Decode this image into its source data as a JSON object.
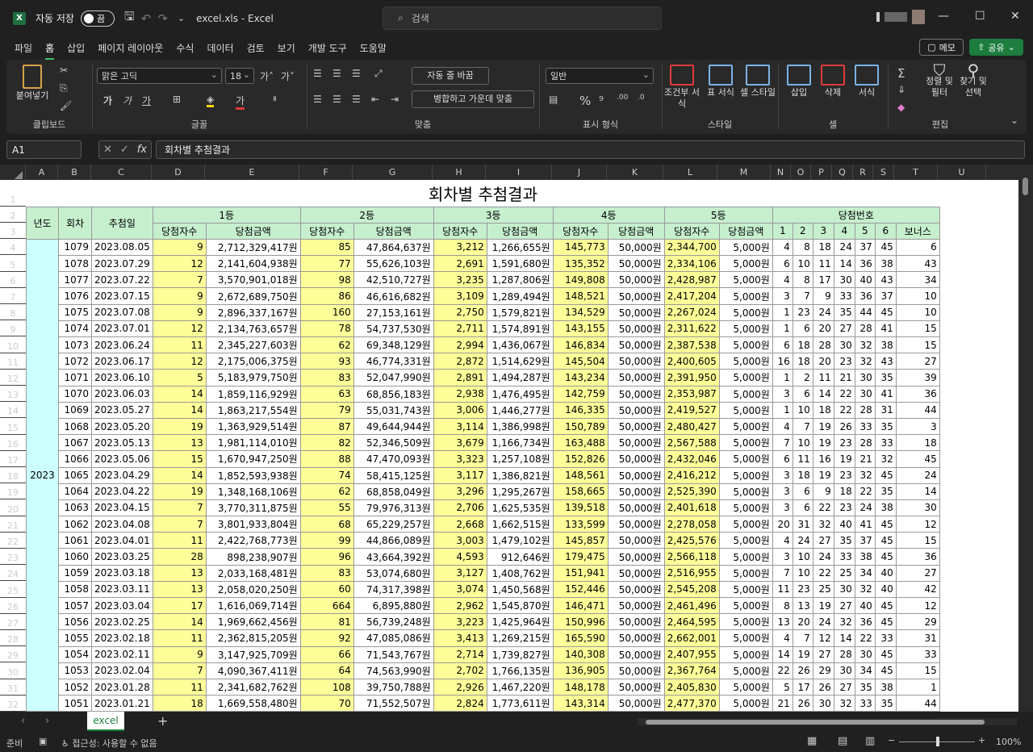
{
  "app": {
    "autosave_label": "자동 저장",
    "toggle_state": "끔",
    "filename": "excel.xls",
    "app_name": "Excel",
    "search_placeholder": "검색"
  },
  "menu": [
    "파일",
    "홈",
    "삽입",
    "페이지 레이아웃",
    "수식",
    "데이터",
    "검토",
    "보기",
    "개발 도구",
    "도움말"
  ],
  "menu_active_index": 1,
  "memo_label": "메모",
  "share_label": "공유",
  "ribbon": {
    "paste": "붙여넣기",
    "clipboard": "클립보드",
    "font_name": "맑은 고딕",
    "font_size": "18",
    "font": "글꼴",
    "wrap": "자동 줄 바꿈",
    "merge": "병합하고 가운데 맞춤",
    "align": "맞춤",
    "numfmt": "일반",
    "numfmt_group": "표시 형식",
    "cond_format": "조건부 서식",
    "table_format": "표 서식",
    "cell_style": "셀 스타일",
    "style_group": "스타일",
    "insert": "삽입",
    "delete": "삭제",
    "format": "서식",
    "cells_group": "셀",
    "sort_filter": "정렬 및 필터",
    "find_select": "찾기 및 선택",
    "edit_group": "편집"
  },
  "formula": {
    "name_box": "A1",
    "content": "회차별 추첨결과"
  },
  "columns": [
    "A",
    "B",
    "C",
    "D",
    "E",
    "F",
    "G",
    "H",
    "I",
    "J",
    "K",
    "L",
    "M",
    "N",
    "O",
    "P",
    "Q",
    "R",
    "S",
    "T",
    "U"
  ],
  "sheet": {
    "title": "회차별 추첨결과",
    "h_year": "년도",
    "h_round": "회차",
    "h_date": "추첨일",
    "ranks": [
      "1등",
      "2등",
      "3등",
      "4등",
      "5등"
    ],
    "h_count": "당첨자수",
    "h_amount": "당첨금액",
    "h_numbers": "당첨번호",
    "num_labels": [
      "1",
      "2",
      "3",
      "4",
      "5",
      "6",
      "보너스"
    ],
    "year": "2023",
    "rows": [
      [
        "1079",
        "2023.08.05",
        "9",
        "2,712,329,417원",
        "85",
        "47,864,637원",
        "3,212",
        "1,266,655원",
        "145,773",
        "50,000원",
        "2,344,700",
        "5,000원",
        "4",
        "8",
        "18",
        "24",
        "37",
        "45",
        "6"
      ],
      [
        "1078",
        "2023.07.29",
        "12",
        "2,141,604,938원",
        "77",
        "55,626,103원",
        "2,691",
        "1,591,680원",
        "135,352",
        "50,000원",
        "2,334,106",
        "5,000원",
        "6",
        "10",
        "11",
        "14",
        "36",
        "38",
        "43"
      ],
      [
        "1077",
        "2023.07.22",
        "7",
        "3,570,901,018원",
        "98",
        "42,510,727원",
        "3,235",
        "1,287,806원",
        "149,808",
        "50,000원",
        "2,428,987",
        "5,000원",
        "4",
        "8",
        "17",
        "30",
        "40",
        "43",
        "34"
      ],
      [
        "1076",
        "2023.07.15",
        "9",
        "2,672,689,750원",
        "86",
        "46,616,682원",
        "3,109",
        "1,289,494원",
        "148,521",
        "50,000원",
        "2,417,204",
        "5,000원",
        "3",
        "7",
        "9",
        "33",
        "36",
        "37",
        "10"
      ],
      [
        "1075",
        "2023.07.08",
        "9",
        "2,896,337,167원",
        "160",
        "27,153,161원",
        "2,750",
        "1,579,821원",
        "134,529",
        "50,000원",
        "2,267,024",
        "5,000원",
        "1",
        "23",
        "24",
        "35",
        "44",
        "45",
        "10"
      ],
      [
        "1074",
        "2023.07.01",
        "12",
        "2,134,763,657원",
        "78",
        "54,737,530원",
        "2,711",
        "1,574,891원",
        "143,155",
        "50,000원",
        "2,311,622",
        "5,000원",
        "1",
        "6",
        "20",
        "27",
        "28",
        "41",
        "15"
      ],
      [
        "1073",
        "2023.06.24",
        "11",
        "2,345,227,603원",
        "62",
        "69,348,129원",
        "2,994",
        "1,436,067원",
        "146,834",
        "50,000원",
        "2,387,538",
        "5,000원",
        "6",
        "18",
        "28",
        "30",
        "32",
        "38",
        "15"
      ],
      [
        "1072",
        "2023.06.17",
        "12",
        "2,175,006,375원",
        "93",
        "46,774,331원",
        "2,872",
        "1,514,629원",
        "145,504",
        "50,000원",
        "2,400,605",
        "5,000원",
        "16",
        "18",
        "20",
        "23",
        "32",
        "43",
        "27"
      ],
      [
        "1071",
        "2023.06.10",
        "5",
        "5,183,979,750원",
        "83",
        "52,047,990원",
        "2,891",
        "1,494,287원",
        "143,234",
        "50,000원",
        "2,391,950",
        "5,000원",
        "1",
        "2",
        "11",
        "21",
        "30",
        "35",
        "39"
      ],
      [
        "1070",
        "2023.06.03",
        "14",
        "1,859,116,929원",
        "63",
        "68,856,183원",
        "2,938",
        "1,476,495원",
        "142,759",
        "50,000원",
        "2,353,987",
        "5,000원",
        "3",
        "6",
        "14",
        "22",
        "30",
        "41",
        "36"
      ],
      [
        "1069",
        "2023.05.27",
        "14",
        "1,863,217,554원",
        "79",
        "55,031,743원",
        "3,006",
        "1,446,277원",
        "146,335",
        "50,000원",
        "2,419,527",
        "5,000원",
        "1",
        "10",
        "18",
        "22",
        "28",
        "31",
        "44"
      ],
      [
        "1068",
        "2023.05.20",
        "19",
        "1,363,929,514원",
        "87",
        "49,644,944원",
        "3,114",
        "1,386,998원",
        "150,789",
        "50,000원",
        "2,480,427",
        "5,000원",
        "4",
        "7",
        "19",
        "26",
        "33",
        "35",
        "3"
      ],
      [
        "1067",
        "2023.05.13",
        "13",
        "1,981,114,010원",
        "82",
        "52,346,509원",
        "3,679",
        "1,166,734원",
        "163,488",
        "50,000원",
        "2,567,588",
        "5,000원",
        "7",
        "10",
        "19",
        "23",
        "28",
        "33",
        "18"
      ],
      [
        "1066",
        "2023.05.06",
        "15",
        "1,670,947,250원",
        "88",
        "47,470,093원",
        "3,323",
        "1,257,108원",
        "152,826",
        "50,000원",
        "2,432,046",
        "5,000원",
        "6",
        "11",
        "16",
        "19",
        "21",
        "32",
        "45"
      ],
      [
        "1065",
        "2023.04.29",
        "14",
        "1,852,593,938원",
        "74",
        "58,415,125원",
        "3,117",
        "1,386,821원",
        "148,561",
        "50,000원",
        "2,416,212",
        "5,000원",
        "3",
        "18",
        "19",
        "23",
        "32",
        "45",
        "24"
      ],
      [
        "1064",
        "2023.04.22",
        "19",
        "1,348,168,106원",
        "62",
        "68,858,049원",
        "3,296",
        "1,295,267원",
        "158,665",
        "50,000원",
        "2,525,390",
        "5,000원",
        "3",
        "6",
        "9",
        "18",
        "22",
        "35",
        "14"
      ],
      [
        "1063",
        "2023.04.15",
        "7",
        "3,770,311,875원",
        "55",
        "79,976,313원",
        "2,706",
        "1,625,535원",
        "139,518",
        "50,000원",
        "2,401,618",
        "5,000원",
        "3",
        "6",
        "22",
        "23",
        "24",
        "38",
        "30"
      ],
      [
        "1062",
        "2023.04.08",
        "7",
        "3,801,933,804원",
        "68",
        "65,229,257원",
        "2,668",
        "1,662,515원",
        "133,599",
        "50,000원",
        "2,278,058",
        "5,000원",
        "20",
        "31",
        "32",
        "40",
        "41",
        "45",
        "12"
      ],
      [
        "1061",
        "2023.04.01",
        "11",
        "2,422,768,773원",
        "99",
        "44,866,089원",
        "3,003",
        "1,479,102원",
        "145,857",
        "50,000원",
        "2,425,576",
        "5,000원",
        "4",
        "24",
        "27",
        "35",
        "37",
        "45",
        "15"
      ],
      [
        "1060",
        "2023.03.25",
        "28",
        "898,238,907원",
        "96",
        "43,664,392원",
        "4,593",
        "912,646원",
        "179,475",
        "50,000원",
        "2,566,118",
        "5,000원",
        "3",
        "10",
        "24",
        "33",
        "38",
        "45",
        "36"
      ],
      [
        "1059",
        "2023.03.18",
        "13",
        "2,033,168,481원",
        "83",
        "53,074,680원",
        "3,127",
        "1,408,762원",
        "151,941",
        "50,000원",
        "2,516,955",
        "5,000원",
        "7",
        "10",
        "22",
        "25",
        "34",
        "40",
        "27"
      ],
      [
        "1058",
        "2023.03.11",
        "13",
        "2,058,020,250원",
        "60",
        "74,317,398원",
        "3,074",
        "1,450,568원",
        "152,446",
        "50,000원",
        "2,545,208",
        "5,000원",
        "11",
        "23",
        "25",
        "30",
        "32",
        "40",
        "42"
      ],
      [
        "1057",
        "2023.03.04",
        "17",
        "1,616,069,714원",
        "664",
        "6,895,880원",
        "2,962",
        "1,545,870원",
        "146,471",
        "50,000원",
        "2,461,496",
        "5,000원",
        "8",
        "13",
        "19",
        "27",
        "40",
        "45",
        "12"
      ],
      [
        "1056",
        "2023.02.25",
        "14",
        "1,969,662,456원",
        "81",
        "56,739,248원",
        "3,223",
        "1,425,964원",
        "150,996",
        "50,000원",
        "2,464,595",
        "5,000원",
        "13",
        "20",
        "24",
        "32",
        "36",
        "45",
        "29"
      ],
      [
        "1055",
        "2023.02.18",
        "11",
        "2,362,815,205원",
        "92",
        "47,085,086원",
        "3,413",
        "1,269,215원",
        "165,590",
        "50,000원",
        "2,662,001",
        "5,000원",
        "4",
        "7",
        "12",
        "14",
        "22",
        "33",
        "31"
      ],
      [
        "1054",
        "2023.02.11",
        "9",
        "3,147,925,709원",
        "66",
        "71,543,767원",
        "2,714",
        "1,739,827원",
        "140,308",
        "50,000원",
        "2,407,955",
        "5,000원",
        "14",
        "19",
        "27",
        "28",
        "30",
        "45",
        "33"
      ],
      [
        "1053",
        "2023.02.04",
        "7",
        "4,090,367,411원",
        "64",
        "74,563,990원",
        "2,702",
        "1,766,135원",
        "136,905",
        "50,000원",
        "2,367,764",
        "5,000원",
        "22",
        "26",
        "29",
        "30",
        "34",
        "45",
        "15"
      ],
      [
        "1052",
        "2023.01.28",
        "11",
        "2,341,682,762원",
        "108",
        "39,750,788원",
        "2,926",
        "1,467,220원",
        "148,178",
        "50,000원",
        "2,405,830",
        "5,000원",
        "5",
        "17",
        "26",
        "27",
        "35",
        "38",
        "1"
      ],
      [
        "1051",
        "2023.01.21",
        "18",
        "1,669,558,480원",
        "70",
        "71,552,507원",
        "2,824",
        "1,773,611원",
        "143,314",
        "50,000원",
        "2,477,370",
        "5,000원",
        "21",
        "26",
        "30",
        "32",
        "33",
        "35",
        "44"
      ]
    ]
  },
  "sheet_tab": "excel",
  "status": {
    "ready": "준비",
    "accessibility": "접근성: 사용할 수 없음",
    "zoom": "100%"
  }
}
